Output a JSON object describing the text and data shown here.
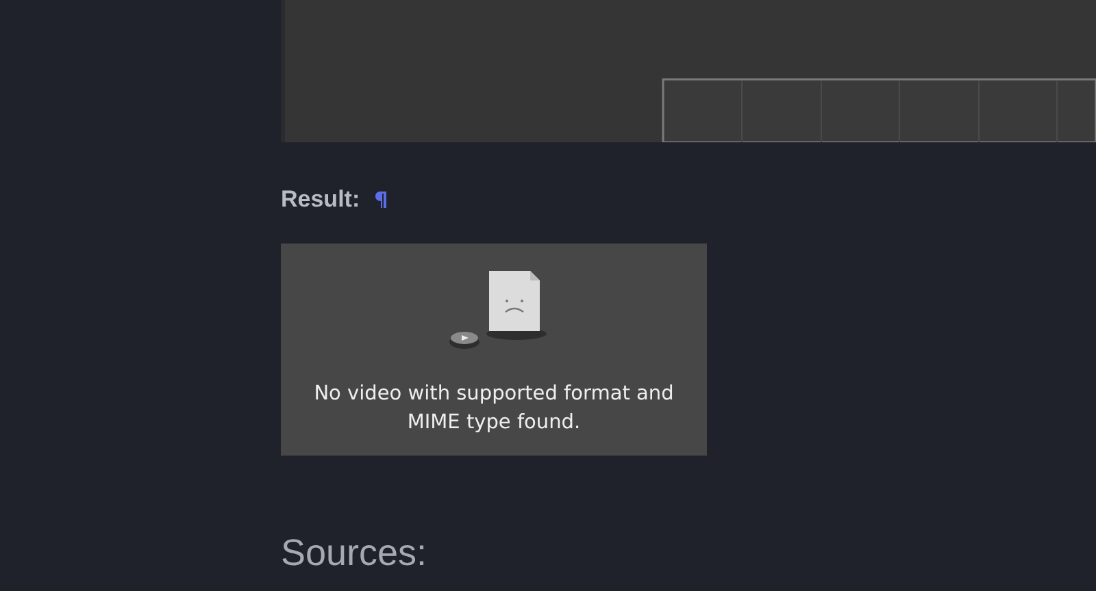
{
  "result": {
    "label": "Result:"
  },
  "video": {
    "message": "No video with supported format and MIME type found."
  },
  "sources": {
    "heading": "Sources:"
  }
}
